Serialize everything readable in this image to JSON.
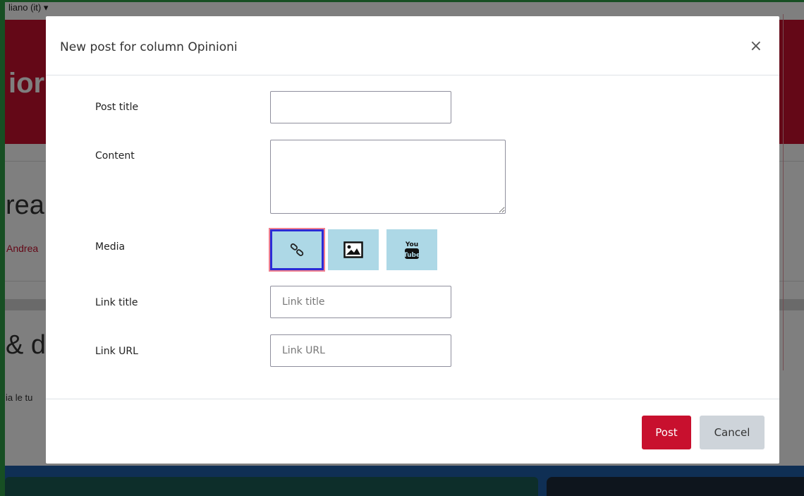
{
  "background": {
    "language_selector": "liano (it)",
    "banner_text": "ior",
    "heading_fragment": "rea",
    "author_fragment": "Andrea",
    "heading2_fragment": "& dc",
    "small_text_fragment": "ia le tu"
  },
  "modal": {
    "title": "New post for column Opinioni",
    "close_glyph": "×",
    "fields": {
      "post_title": {
        "label": "Post title",
        "value": "",
        "placeholder": ""
      },
      "content": {
        "label": "Content",
        "value": "",
        "placeholder": ""
      },
      "media": {
        "label": "Media",
        "buttons": [
          {
            "icon": "link-icon",
            "active": true
          },
          {
            "icon": "image-icon",
            "active": false
          },
          {
            "icon": "youtube-icon",
            "active": false
          }
        ]
      },
      "link_title": {
        "label": "Link title",
        "value": "",
        "placeholder": "Link title"
      },
      "link_url": {
        "label": "Link URL",
        "value": "",
        "placeholder": "Link URL"
      }
    },
    "footer": {
      "post_label": "Post",
      "cancel_label": "Cancel"
    },
    "colors": {
      "primary": "#c8102e",
      "media_button": "#add8e6",
      "cancel": "#ced4da"
    }
  }
}
